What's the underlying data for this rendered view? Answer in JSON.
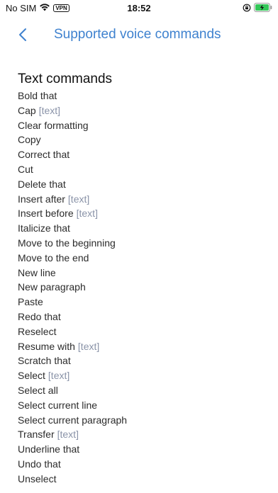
{
  "status_bar": {
    "carrier": "No SIM",
    "vpn": "VPN",
    "time": "18:52",
    "wifi_icon": "wifi-icon",
    "lock_icon": "orientation-lock-icon",
    "battery_icon": "battery-charging-icon"
  },
  "nav": {
    "back_icon": "chevron-left-icon",
    "title": "Supported voice commands"
  },
  "colors": {
    "accent": "#3f82cf",
    "argument": "#8a93a8",
    "text": "#2b2b2b"
  },
  "section": {
    "title": "Text commands"
  },
  "commands": [
    {
      "label": "Bold that",
      "arg": ""
    },
    {
      "label": "Cap",
      "arg": "[text]"
    },
    {
      "label": "Clear formatting",
      "arg": ""
    },
    {
      "label": "Copy",
      "arg": ""
    },
    {
      "label": "Correct that",
      "arg": ""
    },
    {
      "label": "Cut",
      "arg": ""
    },
    {
      "label": "Delete that",
      "arg": ""
    },
    {
      "label": "Insert after",
      "arg": "[text]"
    },
    {
      "label": "Insert before",
      "arg": "[text]"
    },
    {
      "label": "Italicize that",
      "arg": ""
    },
    {
      "label": "Move to the beginning",
      "arg": ""
    },
    {
      "label": "Move to the end",
      "arg": ""
    },
    {
      "label": "New line",
      "arg": ""
    },
    {
      "label": "New paragraph",
      "arg": ""
    },
    {
      "label": "Paste",
      "arg": ""
    },
    {
      "label": "Redo that",
      "arg": ""
    },
    {
      "label": "Reselect",
      "arg": ""
    },
    {
      "label": "Resume with",
      "arg": "[text]"
    },
    {
      "label": "Scratch that",
      "arg": ""
    },
    {
      "label": "Select",
      "arg": "[text]"
    },
    {
      "label": "Select all",
      "arg": ""
    },
    {
      "label": "Select current line",
      "arg": ""
    },
    {
      "label": "Select current paragraph",
      "arg": ""
    },
    {
      "label": "Transfer",
      "arg": "[text]"
    },
    {
      "label": "Underline that",
      "arg": ""
    },
    {
      "label": "Undo that",
      "arg": ""
    },
    {
      "label": "Unselect",
      "arg": ""
    }
  ]
}
